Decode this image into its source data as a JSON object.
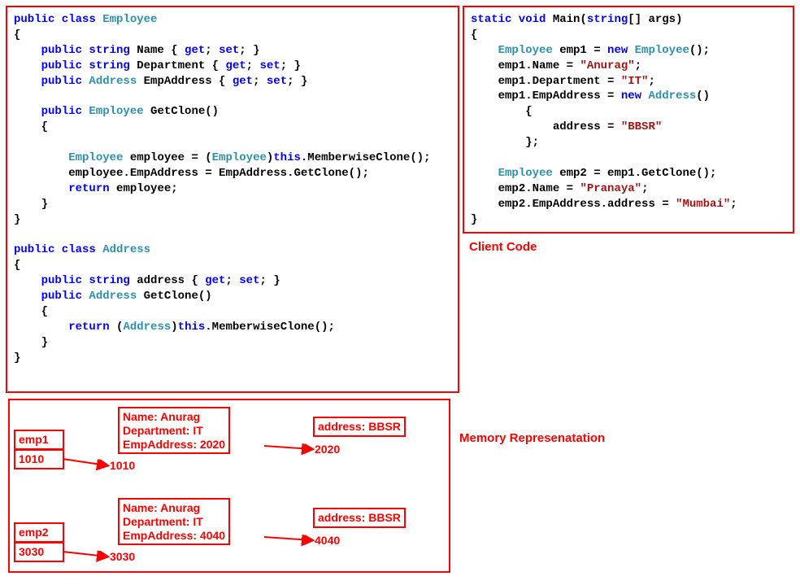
{
  "leftCode": {
    "l1": {
      "a": "public class",
      "b": "Employee"
    },
    "l3": {
      "a": "public string",
      "b": " Name { ",
      "c": "get",
      "d": "; ",
      "e": "set",
      "f": "; }"
    },
    "l4": {
      "a": "public string",
      "b": " Department { ",
      "c": "get",
      "d": "; ",
      "e": "set",
      "f": "; }"
    },
    "l5": {
      "a": "public ",
      "b": "Address",
      "c": " EmpAddress { ",
      "d": "get",
      "e": "; ",
      "f": "set",
      "g": "; }"
    },
    "l7": {
      "a": "public ",
      "b": "Employee",
      "c": " GetClone()"
    },
    "l10": {
      "a": "Employee",
      "b": " employee = (",
      "c": "Employee",
      "d": ")",
      "e": "this",
      "f": ".MemberwiseClone();"
    },
    "l11": "employee.EmpAddress = EmpAddress.GetClone();",
    "l12": {
      "a": "return",
      "b": " employee;"
    },
    "l16": {
      "a": "public class",
      "b": "Address"
    },
    "l18": {
      "a": "public string",
      "b": " address { ",
      "c": "get",
      "d": "; ",
      "e": "set",
      "f": "; }"
    },
    "l19": {
      "a": "public ",
      "b": "Address",
      "c": " GetClone()"
    },
    "l21": {
      "a": "return",
      "b": " (",
      "c": "Address",
      "d": ")",
      "e": "this",
      "f": ".MemberwiseClone();"
    }
  },
  "rightCode": {
    "r1": {
      "a": "static void",
      "b": " Main(",
      "c": "string",
      "d": "[] args)"
    },
    "r3": {
      "a": "Employee",
      "b": " emp1 = ",
      "c": "new ",
      "d": "Employee",
      "e": "();"
    },
    "r4": {
      "a": "emp1.Name = ",
      "b": "\"Anurag\"",
      "c": ";"
    },
    "r5": {
      "a": "emp1.Department = ",
      "b": "\"IT\"",
      "c": ";"
    },
    "r6": {
      "a": "emp1.EmpAddress = ",
      "b": "new ",
      "c": "Address",
      "d": "()"
    },
    "r8": {
      "a": "address = ",
      "b": "\"BBSR\""
    },
    "r11": {
      "a": "Employee",
      "b": " emp2 = emp1.GetClone();"
    },
    "r12": {
      "a": "emp2.Name = ",
      "b": "\"Pranaya\"",
      "c": ";"
    },
    "r13": {
      "a": "emp2.EmpAddress.address = ",
      "b": "\"Mumbai\"",
      "c": ";"
    }
  },
  "labels": {
    "client": "Client Code",
    "memory": "Memory Represenatation"
  },
  "mem": {
    "emp1": {
      "name": "emp1",
      "addr": "1010"
    },
    "emp2": {
      "name": "emp2",
      "addr": "3030"
    },
    "ptr1": "1010",
    "ptr2": "3030",
    "obj1": "Name: Anurag\nDepartment: IT\nEmpAddress: 2020",
    "obj2": "Name: Anurag\nDepartment: IT\nEmpAddress: 4040",
    "addr1ptr": "2020",
    "addr2ptr": "4040",
    "addr1": "address: BBSR",
    "addr2": "address: BBSR"
  },
  "chart_data": {
    "type": "table",
    "title": "Deep-clone memory layout after GetClone()",
    "objects": [
      {
        "var": "emp1",
        "ref": 1010,
        "Name": "Anurag",
        "Department": "IT",
        "EmpAddress_ref": 2020
      },
      {
        "var": "emp2",
        "ref": 3030,
        "Name": "Anurag",
        "Department": "IT",
        "EmpAddress_ref": 4040
      }
    ],
    "addresses": [
      {
        "ref": 2020,
        "address": "BBSR"
      },
      {
        "ref": 4040,
        "address": "BBSR"
      }
    ]
  }
}
